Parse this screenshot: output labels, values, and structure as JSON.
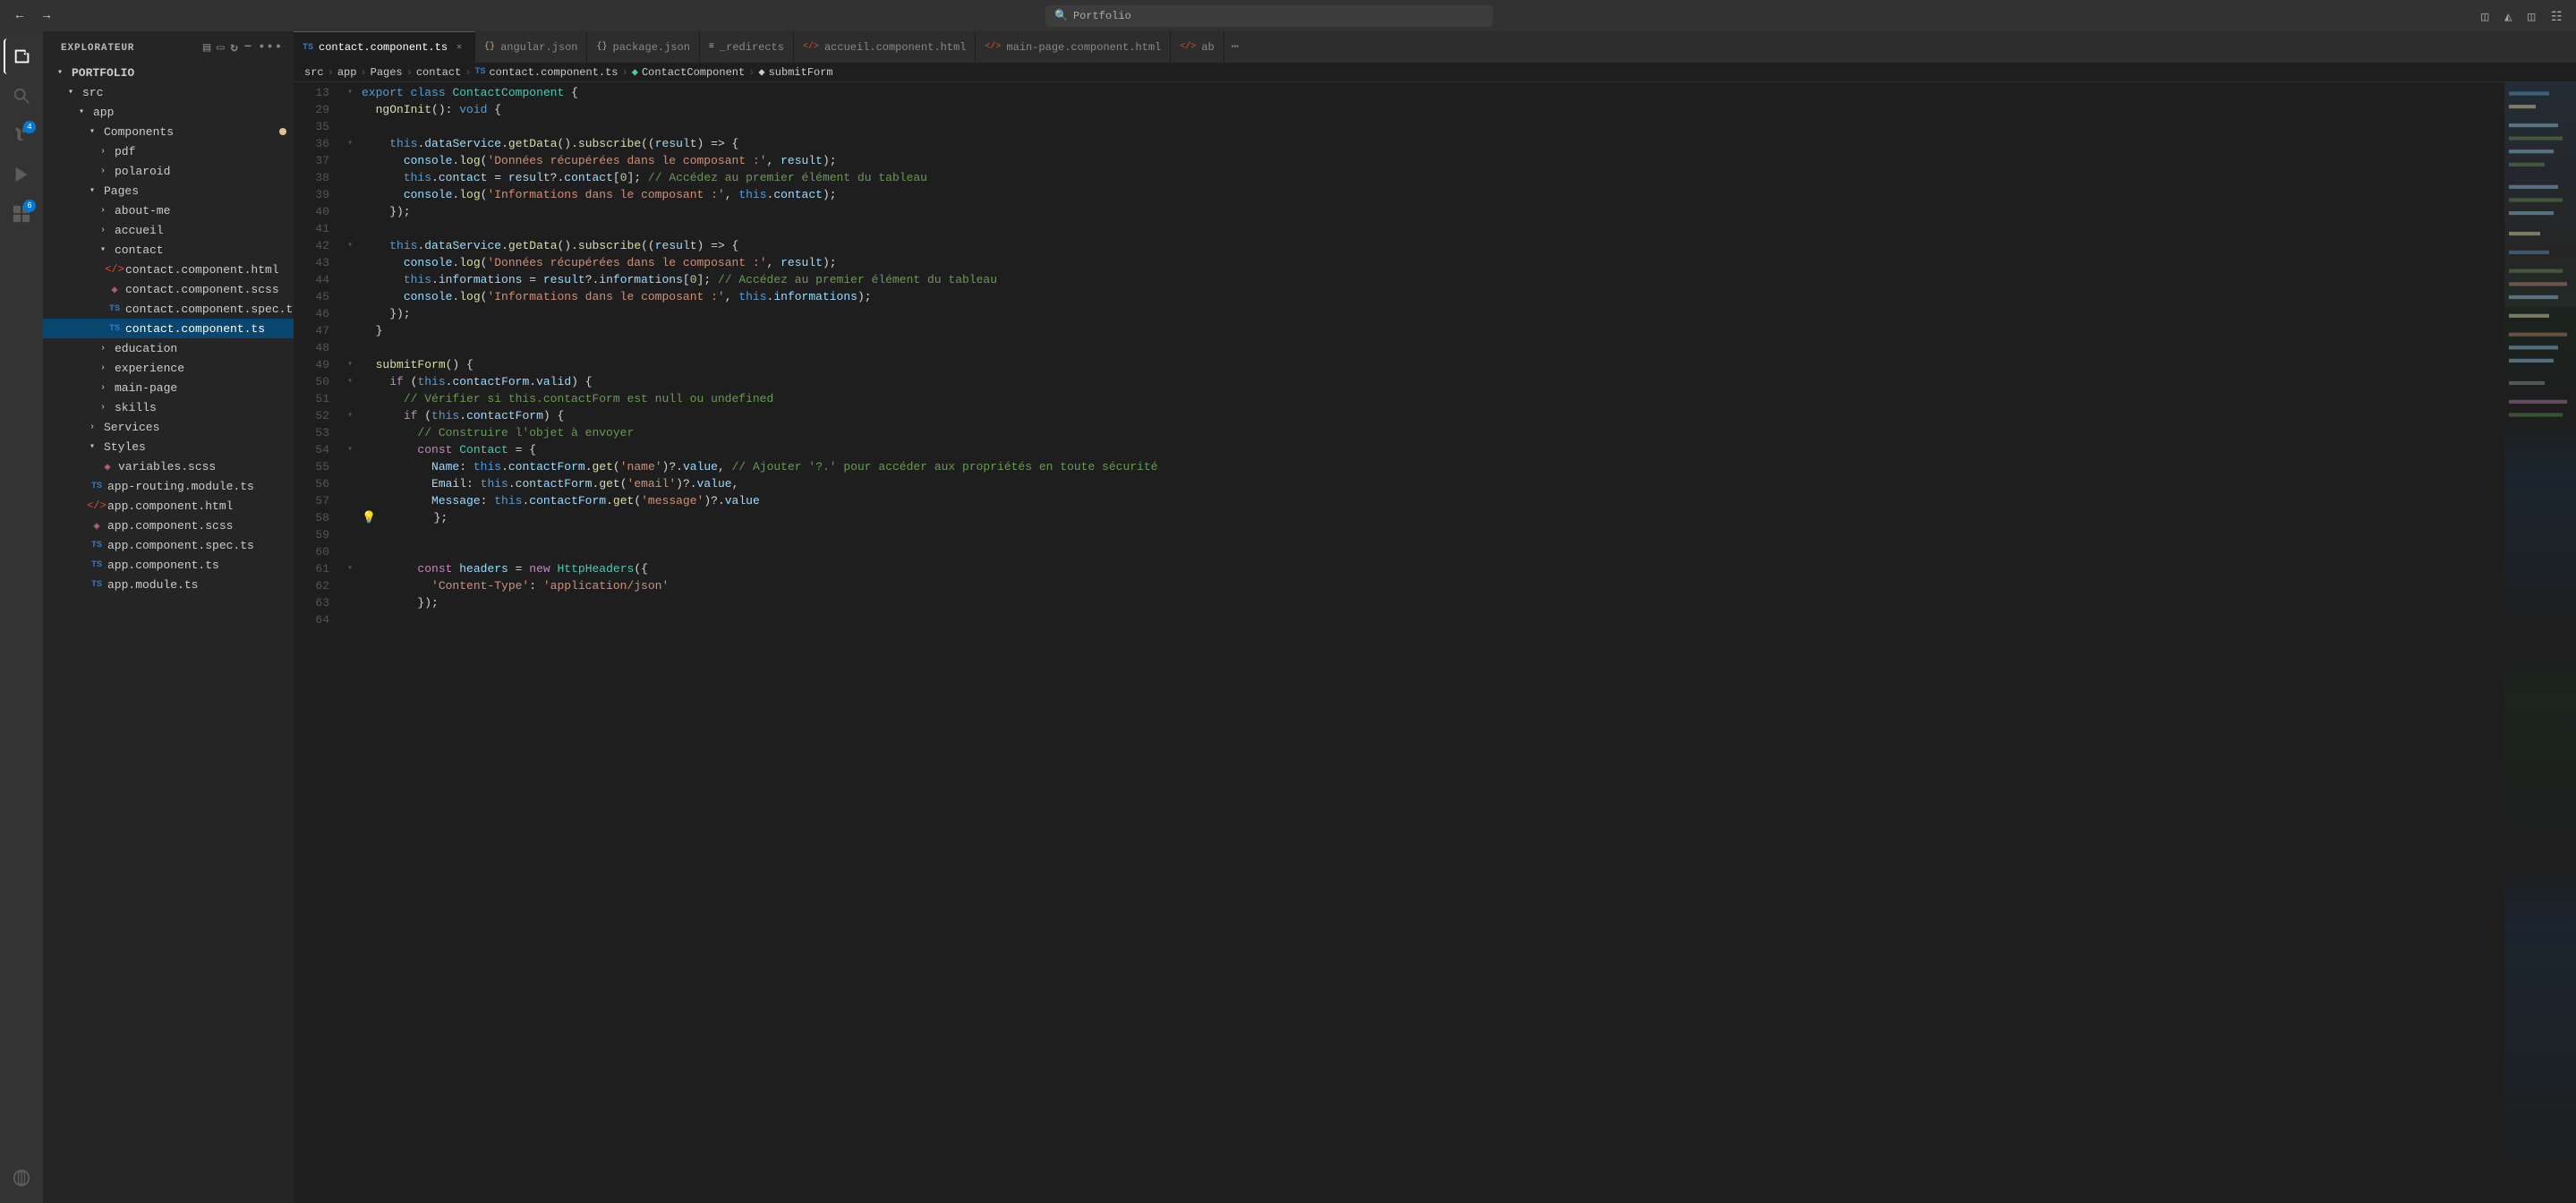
{
  "titleBar": {
    "searchPlaceholder": "Portfolio",
    "navBack": "←",
    "navForward": "→",
    "layoutIcons": [
      "sidebar-left",
      "sidebar-right",
      "split",
      "grid"
    ]
  },
  "activityBar": {
    "icons": [
      {
        "name": "explorer",
        "symbol": "⎘",
        "active": true,
        "badge": null
      },
      {
        "name": "search",
        "symbol": "🔍",
        "active": false,
        "badge": null
      },
      {
        "name": "source-control",
        "symbol": "⑂",
        "active": false,
        "badge": "4"
      },
      {
        "name": "run",
        "symbol": "▷",
        "active": false,
        "badge": null
      },
      {
        "name": "extensions",
        "symbol": "⊞",
        "active": false,
        "badge": "6"
      },
      {
        "name": "remote",
        "symbol": "⊕",
        "active": false,
        "badge": null
      }
    ]
  },
  "sidebar": {
    "title": "EXPLORATEUR",
    "moreIcon": "•••",
    "headerIcons": [
      "new-file",
      "new-folder",
      "refresh",
      "collapse"
    ],
    "rootLabel": "PORTFOLIO",
    "tree": {
      "src": {
        "expanded": true,
        "app": {
          "expanded": true,
          "Components": {
            "expanded": true,
            "dot": "yellow",
            "pdf": {
              "expanded": false
            },
            "polaroid": {
              "expanded": false
            }
          },
          "Pages": {
            "expanded": true,
            "about-me": {
              "expanded": false
            },
            "accueil": {
              "expanded": false
            },
            "contact": {
              "expanded": true,
              "files": [
                {
                  "name": "contact.component.html",
                  "type": "html"
                },
                {
                  "name": "contact.component.scss",
                  "type": "scss"
                },
                {
                  "name": "contact.component.spec.ts",
                  "type": "ts"
                },
                {
                  "name": "contact.component.ts",
                  "type": "ts",
                  "active": true
                }
              ]
            },
            "education": {
              "expanded": false
            },
            "experience": {
              "expanded": false
            },
            "main-page": {
              "expanded": false
            },
            "skills": {
              "expanded": false
            }
          },
          "Services": {
            "expanded": false
          },
          "Styles": {
            "expanded": true,
            "files": [
              {
                "name": "variables.scss",
                "type": "scss"
              }
            ]
          },
          "rootFiles": [
            {
              "name": "app-routing.module.ts",
              "type": "ts"
            },
            {
              "name": "app.component.html",
              "type": "html"
            },
            {
              "name": "app.component.scss",
              "type": "scss"
            },
            {
              "name": "app.component.spec.ts",
              "type": "ts"
            },
            {
              "name": "app.component.ts",
              "type": "ts"
            },
            {
              "name": "app.module.ts",
              "type": "ts"
            }
          ]
        }
      }
    }
  },
  "tabs": [
    {
      "label": "contact.component.ts",
      "type": "ts",
      "active": true,
      "closable": true
    },
    {
      "label": "angular.json",
      "type": "json",
      "active": false,
      "closable": false
    },
    {
      "label": "package.json",
      "type": "json",
      "active": false,
      "closable": false
    },
    {
      "label": "_redirects",
      "type": "redirect",
      "active": false,
      "closable": false
    },
    {
      "label": "accueil.component.html",
      "type": "html",
      "active": false,
      "closable": false
    },
    {
      "label": "main-page.component.html",
      "type": "html",
      "active": false,
      "closable": false
    },
    {
      "label": "ab",
      "type": "ab",
      "active": false,
      "closable": false
    }
  ],
  "breadcrumb": {
    "parts": [
      "src",
      ">",
      "app",
      ">",
      "Pages",
      ">",
      "contact",
      ">",
      "contact.component.ts",
      ">",
      "ContactComponent",
      ">",
      "submitForm"
    ]
  },
  "codeLines": [
    {
      "num": 13,
      "content": "export class ContactComponent {",
      "indent": 0
    },
    {
      "num": 29,
      "content": "  ngOnInit(): void {",
      "indent": 0
    },
    {
      "num": 35,
      "content": "",
      "indent": 0
    },
    {
      "num": 36,
      "content": "    this.dataService.getData().subscribe((result) => {",
      "indent": 0,
      "foldable": true
    },
    {
      "num": 37,
      "content": "      console.log('Données récupérées dans le composant :', result);",
      "indent": 0
    },
    {
      "num": 38,
      "content": "      this.contact = result?.contact[0]; // Accédez au premier élément du tableau",
      "indent": 0
    },
    {
      "num": 39,
      "content": "      console.log('Informations dans le composant :', this.contact);",
      "indent": 0
    },
    {
      "num": 40,
      "content": "    });",
      "indent": 0
    },
    {
      "num": 41,
      "content": "",
      "indent": 0
    },
    {
      "num": 42,
      "content": "    this.dataService.getData().subscribe((result) => {",
      "indent": 0,
      "foldable": true
    },
    {
      "num": 43,
      "content": "      console.log('Données récupérées dans le composant :', result);",
      "indent": 0
    },
    {
      "num": 44,
      "content": "      this.informations = result?.informations[0]; // Accédez au premier élément du tableau",
      "indent": 0
    },
    {
      "num": 45,
      "content": "      console.log('Informations dans le composant :', this.informations);",
      "indent": 0
    },
    {
      "num": 46,
      "content": "    });",
      "indent": 0
    },
    {
      "num": 47,
      "content": "  }",
      "indent": 0
    },
    {
      "num": 48,
      "content": "",
      "indent": 0
    },
    {
      "num": 49,
      "content": "  submitForm() {",
      "indent": 0,
      "foldable": true
    },
    {
      "num": 50,
      "content": "    if (this.contactForm.valid) {",
      "indent": 0,
      "foldable": true
    },
    {
      "num": 51,
      "content": "      // Vérifier si this.contactForm est null ou undefined",
      "indent": 0
    },
    {
      "num": 52,
      "content": "      if (this.contactForm) {",
      "indent": 0,
      "foldable": true
    },
    {
      "num": 53,
      "content": "        // Construire l'objet à envoyer",
      "indent": 0
    },
    {
      "num": 54,
      "content": "        const Contact = {",
      "indent": 0,
      "foldable": true
    },
    {
      "num": 55,
      "content": "          Name: this.contactForm.get('name')?.value, // Ajouter '?.' pour accéder aux propriétés en toute sécurité",
      "indent": 0
    },
    {
      "num": 56,
      "content": "          Email: this.contactForm.get('email')?.value,",
      "indent": 0
    },
    {
      "num": 57,
      "content": "          Message: this.contactForm.get('message')?.value",
      "indent": 0
    },
    {
      "num": 58,
      "content": "        };",
      "indent": 0,
      "lightbulb": true
    },
    {
      "num": 59,
      "content": "",
      "indent": 0
    },
    {
      "num": 60,
      "content": "",
      "indent": 0
    },
    {
      "num": 61,
      "content": "        const headers = new HttpHeaders({",
      "indent": 0,
      "foldable": true
    },
    {
      "num": 62,
      "content": "          'Content-Type': 'application/json'",
      "indent": 0
    },
    {
      "num": 63,
      "content": "        });",
      "indent": 0
    },
    {
      "num": 64,
      "content": "",
      "indent": 0
    }
  ]
}
